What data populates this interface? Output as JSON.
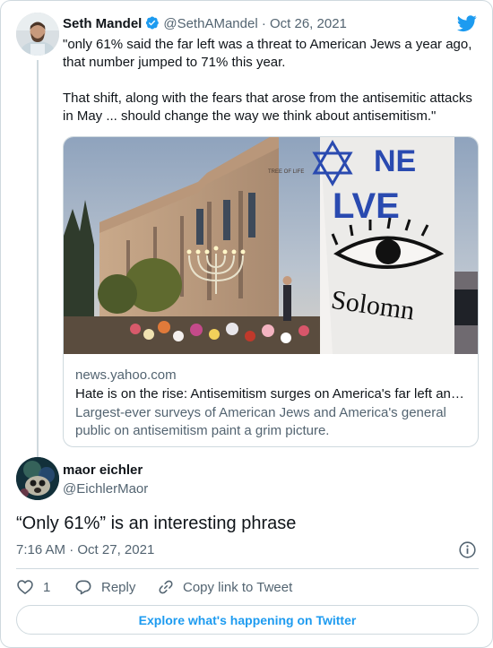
{
  "parent_tweet": {
    "author_name": "Seth Mandel",
    "handle": "@SethAMandel",
    "separator": "·",
    "date": "Oct 26, 2021",
    "paragraphs": [
      "\"only 61% said the far left was a threat to American Jews a year ago, that number jumped to 71% this year.",
      "That shift, along with the fears that arose from the antisemitic attacks in May ... should change the way we think about antisemitism.\""
    ],
    "link_card": {
      "domain": "news.yahoo.com",
      "title": "Hate is on the rise: Antisemitism surges on America's far left an…",
      "description": "Largest-ever surveys of American Jews and America's general public on antisemitism paint a grim picture.",
      "image_texts": {
        "poster_top": "NE",
        "poster_middle": "LVE",
        "poster_bottom": "Solomn",
        "building_sign": "TREE OF LIFE"
      }
    }
  },
  "reply_tweet": {
    "author_name": "maor eichler",
    "handle": "@EichlerMaor",
    "text": "“Only 61%” is an interesting phrase",
    "time": "7:16 AM",
    "separator": "·",
    "date": "Oct 27, 2021"
  },
  "actions": {
    "like_count": "1",
    "reply_label": "Reply",
    "copy_link_label": "Copy link to Tweet"
  },
  "explore_label": "Explore what's happening on Twitter",
  "icons": {
    "brand": "twitter-bird-icon",
    "verified": "verified-badge-icon",
    "info": "info-icon",
    "like": "heart-icon",
    "reply": "speech-bubble-icon",
    "copy": "link-icon"
  },
  "colors": {
    "twitter_blue": "#1d9bf0",
    "text_primary": "#0f1419",
    "text_secondary": "#536471",
    "border": "#cfd9de"
  }
}
